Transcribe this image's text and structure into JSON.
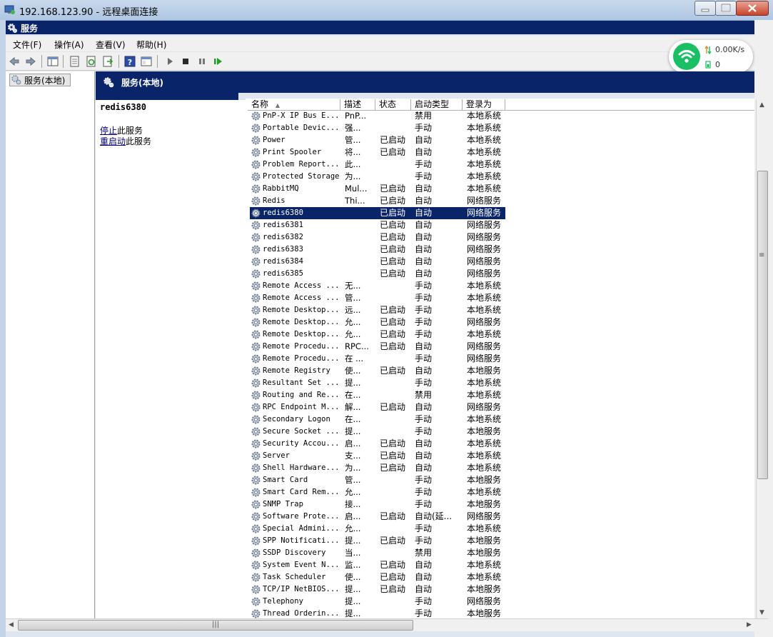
{
  "window": {
    "title": "192.168.123.90 - 远程桌面连接"
  },
  "mmc": {
    "title": "服务"
  },
  "menu": [
    "文件(F)",
    "操作(A)",
    "查看(V)",
    "帮助(H)"
  ],
  "network": {
    "speed": "0.00K/s",
    "count": "0"
  },
  "tree": {
    "root_label": "服务(本地)"
  },
  "header": {
    "title": "服务(本地)"
  },
  "description": {
    "service_name": "redis6380",
    "stop_link": "停止",
    "stop_suffix": "此服务",
    "restart_link": "重启动",
    "restart_suffix": "此服务"
  },
  "columns": {
    "name": "名称",
    "desc": "描述",
    "status": "状态",
    "start_type": "启动类型",
    "logon": "登录为"
  },
  "selected_index": 8,
  "services": [
    {
      "name": "PnP-X IP Bus E...",
      "desc": "PnP...",
      "status": "",
      "start": "禁用",
      "logon": "本地系统"
    },
    {
      "name": "Portable Devic...",
      "desc": "强...",
      "status": "",
      "start": "手动",
      "logon": "本地系统"
    },
    {
      "name": "Power",
      "desc": "管...",
      "status": "已启动",
      "start": "自动",
      "logon": "本地系统"
    },
    {
      "name": "Print Spooler",
      "desc": "将...",
      "status": "已启动",
      "start": "自动",
      "logon": "本地系统"
    },
    {
      "name": "Problem Report...",
      "desc": "此...",
      "status": "",
      "start": "手动",
      "logon": "本地系统"
    },
    {
      "name": "Protected Storage",
      "desc": "为...",
      "status": "",
      "start": "手动",
      "logon": "本地系统"
    },
    {
      "name": "RabbitMQ",
      "desc": "Mul...",
      "status": "已启动",
      "start": "自动",
      "logon": "本地系统"
    },
    {
      "name": "Redis",
      "desc": "Thi...",
      "status": "已启动",
      "start": "自动",
      "logon": "网络服务"
    },
    {
      "name": "redis6380",
      "desc": "",
      "status": "已启动",
      "start": "自动",
      "logon": "网络服务"
    },
    {
      "name": "redis6381",
      "desc": "",
      "status": "已启动",
      "start": "自动",
      "logon": "网络服务"
    },
    {
      "name": "redis6382",
      "desc": "",
      "status": "已启动",
      "start": "自动",
      "logon": "网络服务"
    },
    {
      "name": "redis6383",
      "desc": "",
      "status": "已启动",
      "start": "自动",
      "logon": "网络服务"
    },
    {
      "name": "redis6384",
      "desc": "",
      "status": "已启动",
      "start": "自动",
      "logon": "网络服务"
    },
    {
      "name": "redis6385",
      "desc": "",
      "status": "已启动",
      "start": "自动",
      "logon": "网络服务"
    },
    {
      "name": "Remote Access ...",
      "desc": "无...",
      "status": "",
      "start": "手动",
      "logon": "本地系统"
    },
    {
      "name": "Remote Access ...",
      "desc": "管...",
      "status": "",
      "start": "手动",
      "logon": "本地系统"
    },
    {
      "name": "Remote Desktop...",
      "desc": "远...",
      "status": "已启动",
      "start": "手动",
      "logon": "本地系统"
    },
    {
      "name": "Remote Desktop...",
      "desc": "允...",
      "status": "已启动",
      "start": "手动",
      "logon": "网络服务"
    },
    {
      "name": "Remote Desktop...",
      "desc": "允...",
      "status": "已启动",
      "start": "手动",
      "logon": "本地系统"
    },
    {
      "name": "Remote Procedu...",
      "desc": "RPC...",
      "status": "已启动",
      "start": "自动",
      "logon": "网络服务"
    },
    {
      "name": "Remote Procedu...",
      "desc": "在 ...",
      "status": "",
      "start": "手动",
      "logon": "网络服务"
    },
    {
      "name": "Remote Registry",
      "desc": "使...",
      "status": "已启动",
      "start": "自动",
      "logon": "本地服务"
    },
    {
      "name": "Resultant Set ...",
      "desc": "提...",
      "status": "",
      "start": "手动",
      "logon": "本地系统"
    },
    {
      "name": "Routing and Re...",
      "desc": "在...",
      "status": "",
      "start": "禁用",
      "logon": "本地系统"
    },
    {
      "name": "RPC Endpoint M...",
      "desc": "解...",
      "status": "已启动",
      "start": "自动",
      "logon": "网络服务"
    },
    {
      "name": "Secondary Logon",
      "desc": "在...",
      "status": "",
      "start": "手动",
      "logon": "本地系统"
    },
    {
      "name": "Secure Socket ...",
      "desc": "提...",
      "status": "",
      "start": "手动",
      "logon": "本地服务"
    },
    {
      "name": "Security Accou...",
      "desc": "启...",
      "status": "已启动",
      "start": "自动",
      "logon": "本地系统"
    },
    {
      "name": "Server",
      "desc": "支...",
      "status": "已启动",
      "start": "自动",
      "logon": "本地系统"
    },
    {
      "name": "Shell Hardware...",
      "desc": "为...",
      "status": "已启动",
      "start": "自动",
      "logon": "本地系统"
    },
    {
      "name": "Smart Card",
      "desc": "管...",
      "status": "",
      "start": "手动",
      "logon": "本地服务"
    },
    {
      "name": "Smart Card Rem...",
      "desc": "允...",
      "status": "",
      "start": "手动",
      "logon": "本地系统"
    },
    {
      "name": "SNMP Trap",
      "desc": "接...",
      "status": "",
      "start": "手动",
      "logon": "本地服务"
    },
    {
      "name": "Software Prote...",
      "desc": "启...",
      "status": "已启动",
      "start": "自动(延...",
      "logon": "网络服务"
    },
    {
      "name": "Special Admini...",
      "desc": "允...",
      "status": "",
      "start": "手动",
      "logon": "本地系统"
    },
    {
      "name": "SPP Notificati...",
      "desc": "提...",
      "status": "已启动",
      "start": "手动",
      "logon": "本地服务"
    },
    {
      "name": "SSDP Discovery",
      "desc": "当...",
      "status": "",
      "start": "禁用",
      "logon": "本地服务"
    },
    {
      "name": "System Event N...",
      "desc": "监...",
      "status": "已启动",
      "start": "自动",
      "logon": "本地系统"
    },
    {
      "name": "Task Scheduler",
      "desc": "使...",
      "status": "已启动",
      "start": "自动",
      "logon": "本地系统"
    },
    {
      "name": "TCP/IP NetBIOS...",
      "desc": "提...",
      "status": "已启动",
      "start": "自动",
      "logon": "本地服务"
    },
    {
      "name": "Telephony",
      "desc": "提...",
      "status": "",
      "start": "手动",
      "logon": "网络服务"
    },
    {
      "name": "Thread Orderin...",
      "desc": "提...",
      "status": "",
      "start": "手动",
      "logon": "本地服务"
    }
  ]
}
